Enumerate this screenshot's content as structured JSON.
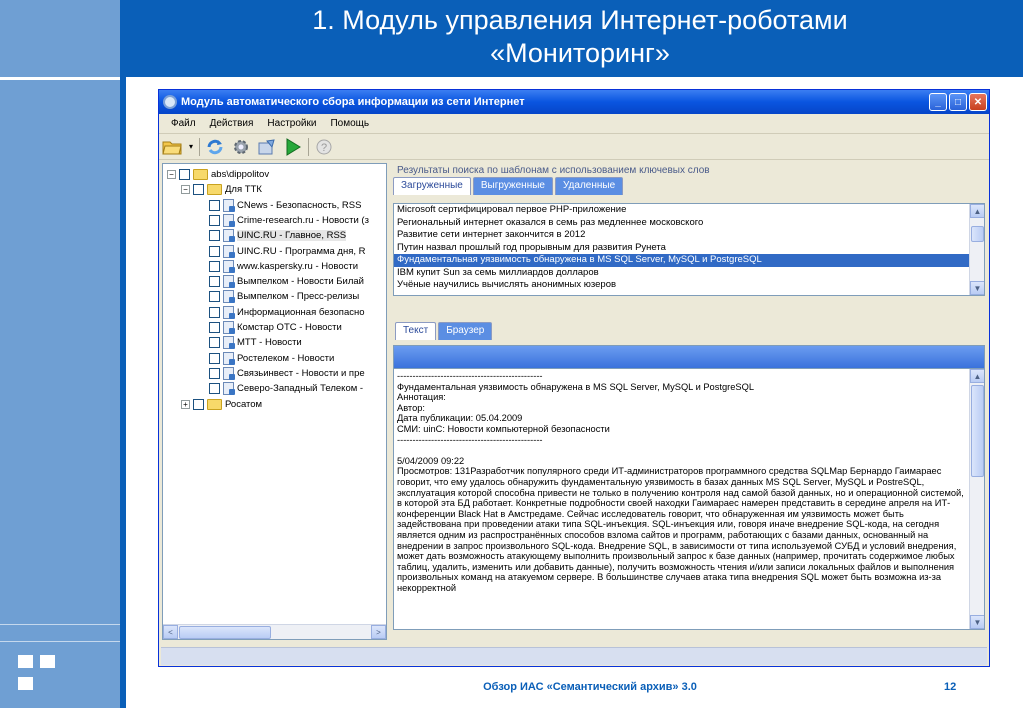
{
  "slide": {
    "title_line1": "1. Модуль управления Интернет-роботами",
    "title_line2": "«Мониторинг»",
    "footer": "Обзор ИАС «Семантический архив» 3.0",
    "page_number": "12"
  },
  "window": {
    "title": "Модуль автоматического сбора информации из сети Интернет",
    "controls": {
      "minimize": "_",
      "maximize": "□",
      "close": "✕"
    }
  },
  "menu": [
    "Файл",
    "Действия",
    "Настройки",
    "Помощь"
  ],
  "toolbar": {
    "icons": [
      "folder-icon",
      "refresh-icon",
      "settings-gear-icon",
      "tools-icon",
      "play-icon",
      "help-icon"
    ]
  },
  "tree": {
    "items": [
      {
        "label": "abs\\dippolitov",
        "expander": "−",
        "icon": "folder"
      },
      {
        "label": "Для ТТК",
        "expander": "−",
        "icon": "folder"
      },
      {
        "label": "CNews - Безопасность, RSS",
        "icon": "doc"
      },
      {
        "label": "Crime-research.ru - Новости (з",
        "icon": "doc"
      },
      {
        "label": "UINC.RU - Главное, RSS",
        "icon": "doc",
        "selected": true
      },
      {
        "label": "UINC.RU - Программа дня, R",
        "icon": "doc"
      },
      {
        "label": "www.kaspersky.ru - Новости",
        "icon": "doc"
      },
      {
        "label": "Вымпелком - Новости Билай",
        "icon": "doc"
      },
      {
        "label": "Вымпелком - Пресс-релизы",
        "icon": "doc"
      },
      {
        "label": "Информационная безопасно",
        "icon": "doc"
      },
      {
        "label": "Комстар ОТС - Новости",
        "icon": "doc"
      },
      {
        "label": "МТТ - Новости",
        "icon": "doc"
      },
      {
        "label": "Ростелеком - Новости",
        "icon": "doc"
      },
      {
        "label": "Связьинвест - Новости и пре",
        "icon": "doc"
      },
      {
        "label": "Северо-Западный Телеком -",
        "icon": "doc"
      },
      {
        "label": "Росатом",
        "expander": "+",
        "icon": "folder"
      }
    ],
    "scroll_left": "<",
    "scroll_right": ">"
  },
  "results": {
    "caption": "Результаты поиска по шаблонам с использованием ключевых слов",
    "tabs": [
      "Загруженные",
      "Выгруженные",
      "Удаленные"
    ],
    "rows": [
      "Microsoft сертифицировал первое PHP-приложение",
      "Региональный интернет оказался в семь раз медленнее московского",
      "Развитие сети интернет закончится в 2012",
      "Путин назвал прошлый год прорывным для развития Рунета",
      "Фундаментальная уязвимость обнаружена в MS SQL Server, MySQL и PostgreSQL",
      "IBM купит Sun за семь миллиардов долларов",
      "Учёные научились вычислять анонимных юзеров"
    ],
    "selected_row": 4
  },
  "detail": {
    "tabs": [
      "Текст",
      "Браузер"
    ],
    "lines": [
      "-----------------------------------------------",
      "Фундаментальная уязвимость обнаружена в MS SQL Server, MySQL и PostgreSQL",
      "Аннотация:",
      "Автор:",
      "Дата публикации: 05.04.2009",
      "СМИ: uinC: Новости компьютерной безопасности",
      "-----------------------------------------------",
      "",
      "5/04/2009 09:22"
    ],
    "paragraph": "Просмотров: 131Разработчик популярного среди ИТ-администраторов программного средства SQLMap Бернардо Гаимарaес говорит, что ему удалось обнаружить фундаментальную уязвимость в базах данных MS SQL Server, MySQL и PostreSQL, эксплуатация которой способна привести не только в получению контроля над самой базой данных, но и операционной системой, в которой эта БД работает. Конкретные подробности своей находки Гаимарaес намерен представить в середине апреля на ИТ-конференции Black Hat в Амстредаме. Сейчас исследователь говорит, что обнаруженная им уязвимость может быть задействована при проведении атаки типа SQL-инъекция. SQL-инъекция или, говоря иначе внедрение SQL-кода, на сегодня является одним из распространённых способов взлома сайтов и программ, работающих с базами данных, основанный на внедрении в запрос произвольного SQL-кода. Внедрение SQL, в зависимости от типа используемой СУБД и условий внедрения, может дать возможность атакующему выполнить произвольный запрос к базе данных (например, прочитать содержимое любых таблиц, удалить, изменить или добавить данные), получить возможность чтения и/или записи локальных файлов и выполнения произвольных команд на атакуемом сервере. В большинстве случаев атака типа внедрения SQL может быть возможна из-за некорректной"
  }
}
